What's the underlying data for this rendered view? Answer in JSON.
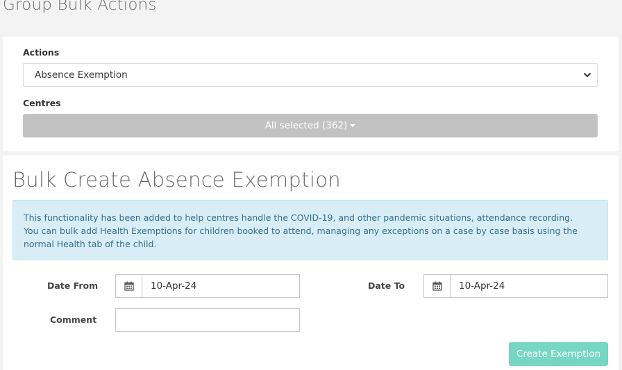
{
  "page": {
    "title": "Group Bulk Actions"
  },
  "filters": {
    "actions_label": "Actions",
    "actions_value": "Absence Exemption",
    "centres_label": "Centres",
    "centres_value": "All selected (362)"
  },
  "section": {
    "title": "Bulk Create Absence Exemption",
    "info_line1": "This functionality has been added to help centres handle the COVID-19, and other pandemic situations, attendance recording.",
    "info_line2": "You can bulk add Health Exemptions for children booked to attend, managing any exceptions on a case by case basis using the normal Health tab of the child."
  },
  "form": {
    "date_from_label": "Date From",
    "date_from_value": "10-Apr-24",
    "date_to_label": "Date To",
    "date_to_value": "10-Apr-24",
    "comment_label": "Comment",
    "comment_value": "",
    "submit_label": "Create Exemption"
  },
  "icons": {
    "calendar": "calendar-icon",
    "chevron": "chevron-down-icon",
    "caret": "caret-down-icon"
  },
  "colors": {
    "multiselect_bg": "#c2c2c2",
    "info_bg": "#d9edf7",
    "info_text": "#31708f",
    "primary_button": "#76d7c4"
  }
}
